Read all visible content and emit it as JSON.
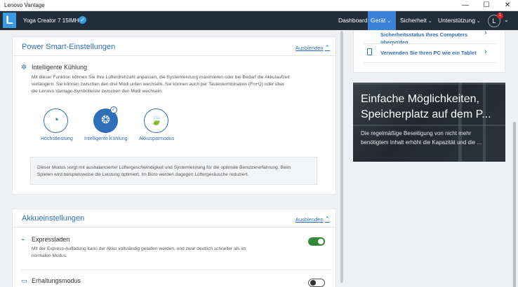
{
  "window": {
    "title": "Lenovo Vantage",
    "minimize": "—",
    "maximize": "☐",
    "close": "✕"
  },
  "header": {
    "logo": "L",
    "device_name": "Yoga Creator 7 15IMH05",
    "verified_glyph": "✓",
    "nav": [
      {
        "label": "Dashboard",
        "active": false,
        "chevron": ""
      },
      {
        "label": "Gerät",
        "active": true,
        "chevron": "⌄"
      },
      {
        "label": "Sicherheit",
        "active": false,
        "chevron": "⌄"
      },
      {
        "label": "Unterstützung",
        "active": false,
        "chevron": "⌄"
      }
    ],
    "user_initial": "L",
    "notification_count": "1",
    "user_chevron": "⌄",
    "accent_color": "#3b82d6"
  },
  "power_smart": {
    "title": "Power Smart-Einstellungen",
    "hide_label": "Ausblenden",
    "hide_glyph": "⌃",
    "section_title": "Intelligente Kühlung",
    "description_lines": [
      "Mit dieser Funktion können Sie Ihre Lüfterdrehzahl anpassen, die Systemleistung maximieren oder bei Bedarf die Akkulaufzeit",
      "verlängern. Sie können zwischen den drei Modi unten wechseln. Sie können auch per Tastenkombination (Fn+Q) oder über",
      "die Lenovo Vantage-Symbolleiste zwischen den Modi wechseln."
    ],
    "modes": [
      {
        "label": "Höchstleistung",
        "icon": "speedometer-icon",
        "glyph": "◔",
        "selected": false
      },
      {
        "label": "Intelligente Kühlung",
        "icon": "smart-cooling-icon",
        "glyph": "❂",
        "selected": true
      },
      {
        "label": "Akkusparmodus",
        "icon": "battery-saver-icon",
        "glyph": "🍃",
        "selected": false
      }
    ],
    "mode_info_lines": [
      "Dieser Modus sorgt mit ausbalancierter Lüftergeschwindigkeit und Systemleistung für die optimale Benutzererfahrung. Beim",
      "Spielen wird beispielsweise die Leistung optimiert. Im Büro werden dagegen Lüftergeräusche reduziert."
    ]
  },
  "akku": {
    "title": "Akkueinstellungen",
    "hide_label": "Ausblenden",
    "hide_glyph": "⌃",
    "express": {
      "title": "Expressladen",
      "description_lines": [
        "Mit der Express-Aufladung kann der Akku vollständig geladen werden, und zwar deutlich schneller als im",
        "normalen Modus."
      ],
      "enabled": true
    },
    "conservation": {
      "title": "Erhaltungsmodus",
      "enabled": false
    }
  },
  "right_panel": {
    "links": [
      {
        "label": "Sicherheitsstatus Ihres Computers überprüfen",
        "chevron": "›"
      },
      {
        "label": "Verwenden Sie Ihren PC wie ein Tablet",
        "chevron": "›"
      }
    ],
    "promo": {
      "title_line1": "Einfache Möglichkeiten,",
      "title_line2": "Speicherplatz auf dem P...",
      "text_line1": "Die regelmäßige Beseitigung von nicht mehr",
      "text_line2": "benötigtem Inhalt erhöht die Kapazität und die ..."
    }
  }
}
